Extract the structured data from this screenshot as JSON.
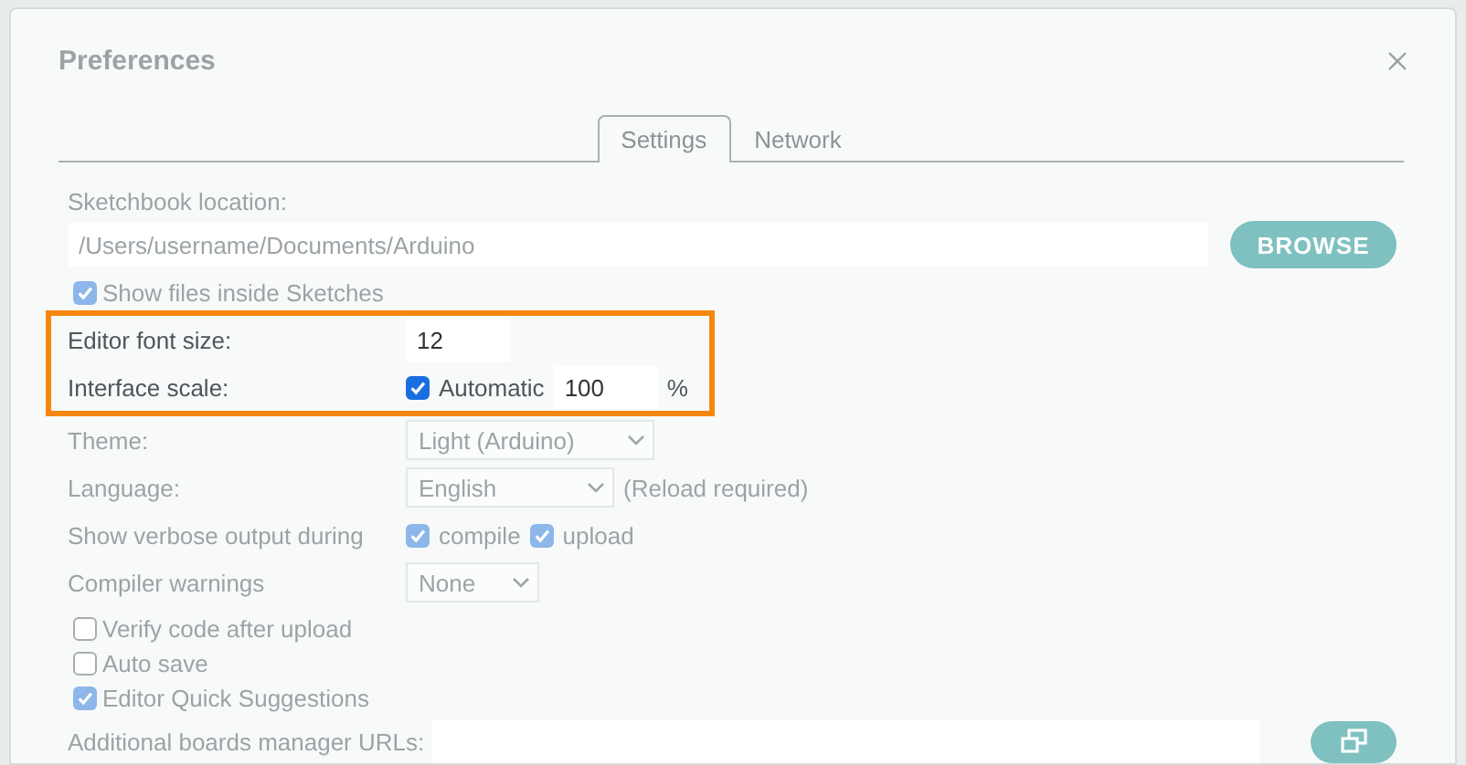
{
  "dialog": {
    "title": "Preferences"
  },
  "tabs": [
    {
      "label": "Settings",
      "selected": true
    },
    {
      "label": "Network",
      "selected": false
    }
  ],
  "sketchbook": {
    "label": "Sketchbook location:",
    "value": "/Users/username/Documents/Arduino",
    "button": "BROWSE"
  },
  "show_files": {
    "label": "Show files inside Sketches",
    "checked": true
  },
  "rows": [
    {
      "kind": "number",
      "label": "Editor font size:",
      "value": "12",
      "highlighted": true
    },
    {
      "kind": "scale",
      "label": "Interface scale:",
      "check": {
        "label": "Automatic",
        "checked": true
      },
      "value": "100",
      "unit": "%",
      "highlighted": true
    },
    {
      "kind": "select",
      "label": "Theme:",
      "value": "Light (Arduino)",
      "highlighted": false
    },
    {
      "kind": "select",
      "label": "Language:",
      "value": "English",
      "note": "(Reload required)",
      "highlighted": false
    },
    {
      "kind": "checks",
      "label": "Show verbose output during",
      "options": [
        {
          "label": "compile",
          "checked": true
        },
        {
          "label": "upload",
          "checked": true
        }
      ],
      "highlighted": false
    },
    {
      "kind": "select",
      "label": "Compiler warnings",
      "value": "None",
      "highlighted": false
    }
  ],
  "options": [
    {
      "label": "Verify code after upload",
      "checked": false
    },
    {
      "label": "Auto save",
      "checked": false
    },
    {
      "label": "Editor Quick Suggestions",
      "checked": true
    }
  ],
  "boards_urls": {
    "label": "Additional boards manager URLs:"
  }
}
